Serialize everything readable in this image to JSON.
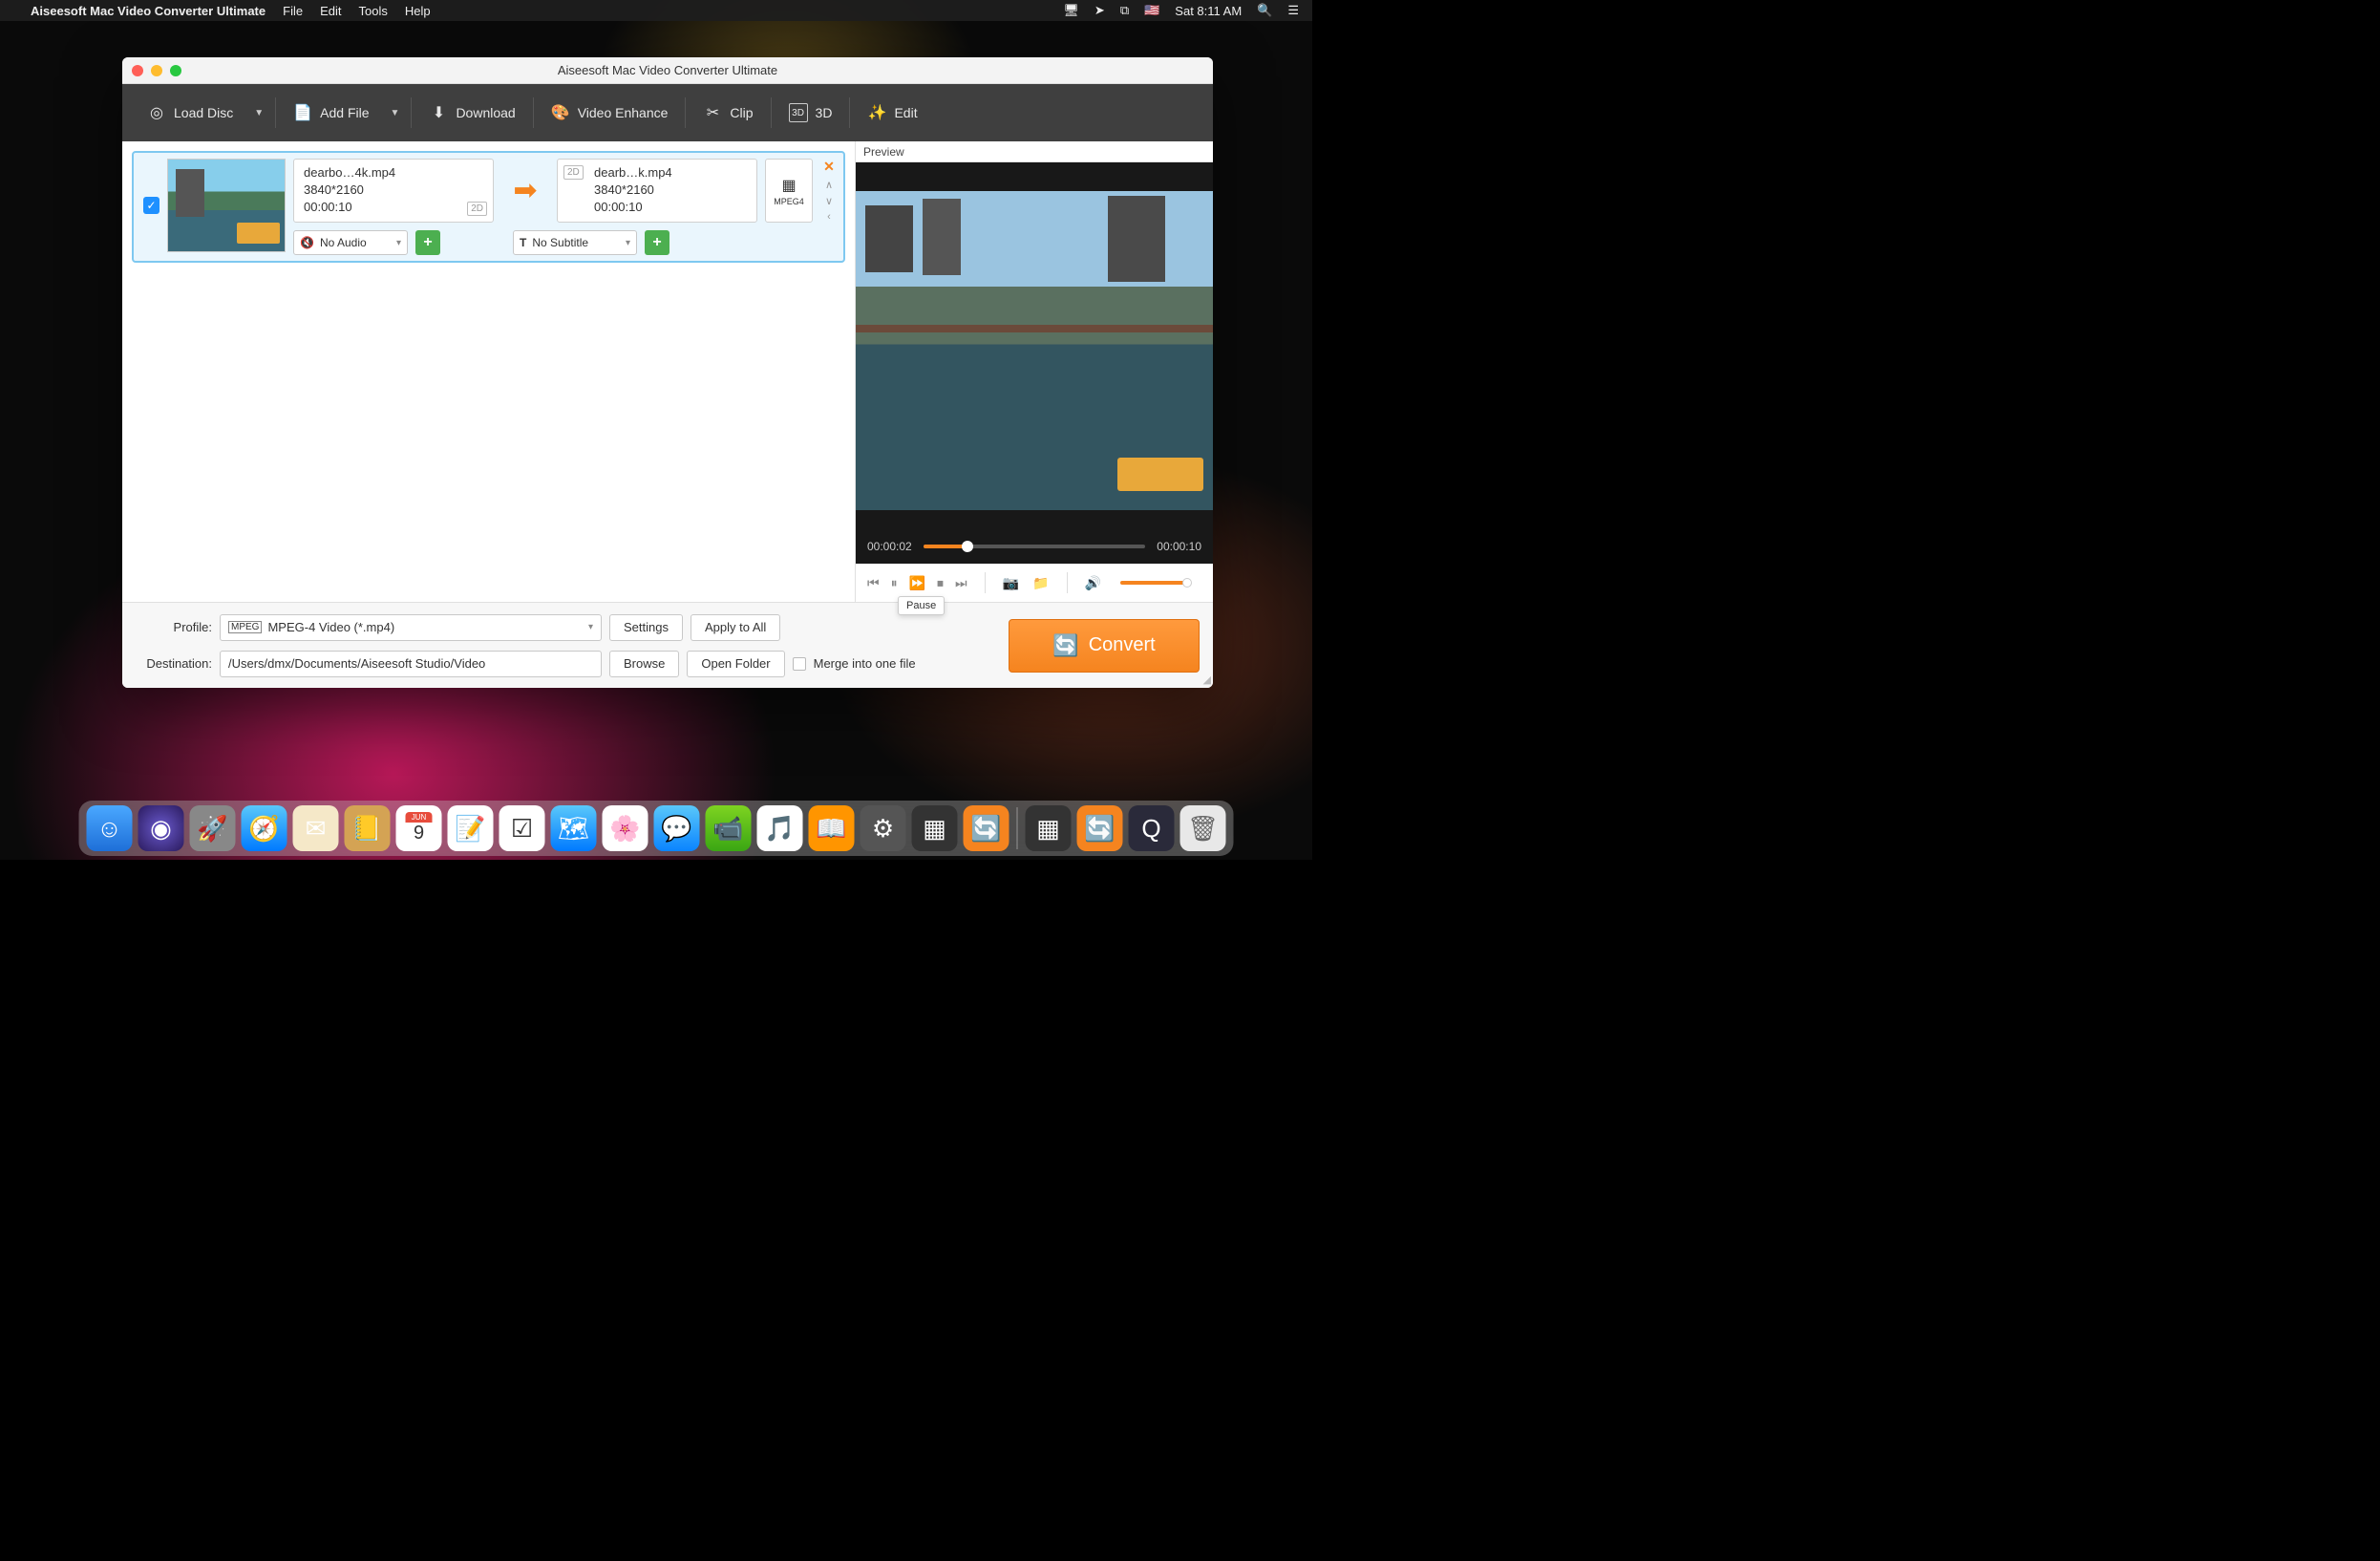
{
  "menubar": {
    "app": "Aiseesoft Mac Video Converter Ultimate",
    "items": [
      "File",
      "Edit",
      "Tools",
      "Help"
    ],
    "clock": "Sat 8:11 AM"
  },
  "window": {
    "title": "Aiseesoft Mac Video Converter Ultimate"
  },
  "toolbar": {
    "load_disc": "Load Disc",
    "add_file": "Add File",
    "download": "Download",
    "enhance": "Video Enhance",
    "clip": "Clip",
    "threeD": "3D",
    "edit": "Edit"
  },
  "item": {
    "src": {
      "name": "dearbo…4k.mp4",
      "res": "3840*2160",
      "dur": "00:00:10",
      "badge": "2D"
    },
    "dst": {
      "name": "dearb…k.mp4",
      "res": "3840*2160",
      "dur": "00:00:10",
      "badge": "2D"
    },
    "audio": "No Audio",
    "subtitle": "No Subtitle",
    "fmt": "MPEG4"
  },
  "preview": {
    "label": "Preview",
    "cur": "00:00:02",
    "total": "00:00:10",
    "tooltip": "Pause"
  },
  "bottom": {
    "profile_label": "Profile:",
    "profile_value": "MPEG-4 Video (*.mp4)",
    "dest_label": "Destination:",
    "dest_value": "/Users/dmx/Documents/Aiseesoft Studio/Video",
    "settings": "Settings",
    "apply": "Apply to All",
    "browse": "Browse",
    "open": "Open Folder",
    "merge": "Merge into one file",
    "convert": "Convert"
  }
}
